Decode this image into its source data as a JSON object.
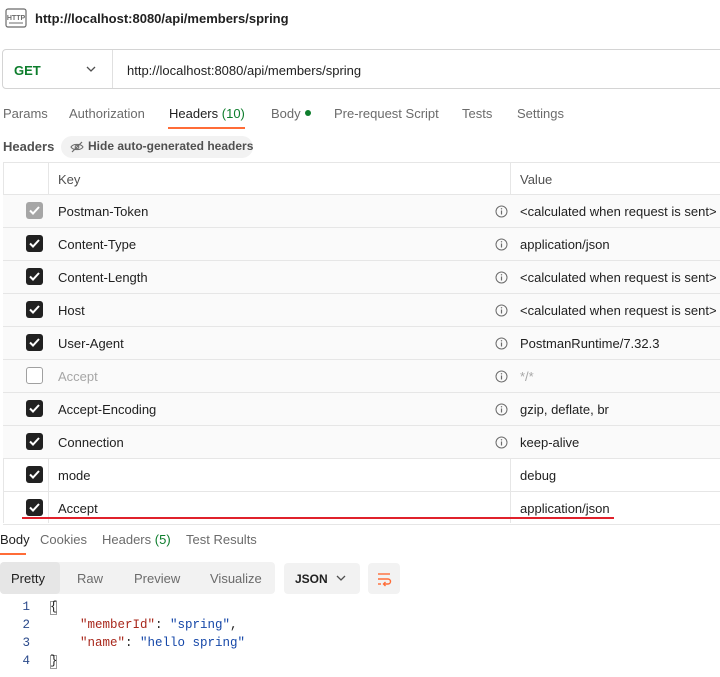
{
  "request": {
    "title": "http://localhost:8080/api/members/spring",
    "method": "GET",
    "url": "http://localhost:8080/api/members/spring"
  },
  "tabs": [
    {
      "label": "Params"
    },
    {
      "label": "Authorization"
    },
    {
      "label": "Headers",
      "count": "(10)"
    },
    {
      "label": "Body"
    },
    {
      "label": "Pre-request Script"
    },
    {
      "label": "Tests"
    },
    {
      "label": "Settings"
    }
  ],
  "headers_section": {
    "label": "Headers",
    "toggle_label": "Hide auto-generated headers"
  },
  "table": {
    "columns": [
      "Key",
      "Value"
    ],
    "rows": [
      {
        "key": "Postman-Token",
        "value": "<calculated when request is sent>",
        "state": "grey"
      },
      {
        "key": "Content-Type",
        "value": "application/json",
        "state": "on"
      },
      {
        "key": "Content-Length",
        "value": "<calculated when request is sent>",
        "state": "on"
      },
      {
        "key": "Host",
        "value": "<calculated when request is sent>",
        "state": "on"
      },
      {
        "key": "User-Agent",
        "value": "PostmanRuntime/7.32.3",
        "state": "on"
      },
      {
        "key": "Accept",
        "value": "*/*",
        "state": "off"
      },
      {
        "key": "Accept-Encoding",
        "value": "gzip, deflate, br",
        "state": "on"
      },
      {
        "key": "Connection",
        "value": "keep-alive",
        "state": "on"
      },
      {
        "key": "mode",
        "value": "debug",
        "state": "on"
      },
      {
        "key": "Accept",
        "value": "application/json",
        "state": "on"
      }
    ]
  },
  "response": {
    "tabs": [
      {
        "label": "Body"
      },
      {
        "label": "Cookies"
      },
      {
        "label": "Headers",
        "count": "(5)"
      },
      {
        "label": "Test Results"
      }
    ],
    "views": [
      "Pretty",
      "Raw",
      "Preview",
      "Visualize"
    ],
    "format": "JSON",
    "code": {
      "line_numbers": [
        "1",
        "2",
        "3",
        "4"
      ],
      "open": "{",
      "close": "}",
      "fields": [
        {
          "key": "\"memberId\"",
          "sep": ": ",
          "value": "\"spring\"",
          "tail": ","
        },
        {
          "key": "\"name\"",
          "sep": ": ",
          "value": "\"hello spring\"",
          "tail": ""
        }
      ]
    }
  },
  "colors": {
    "accent": "#ff6c37",
    "method_get": "#0d7d2c",
    "highlight_underline": "#e0212b"
  }
}
